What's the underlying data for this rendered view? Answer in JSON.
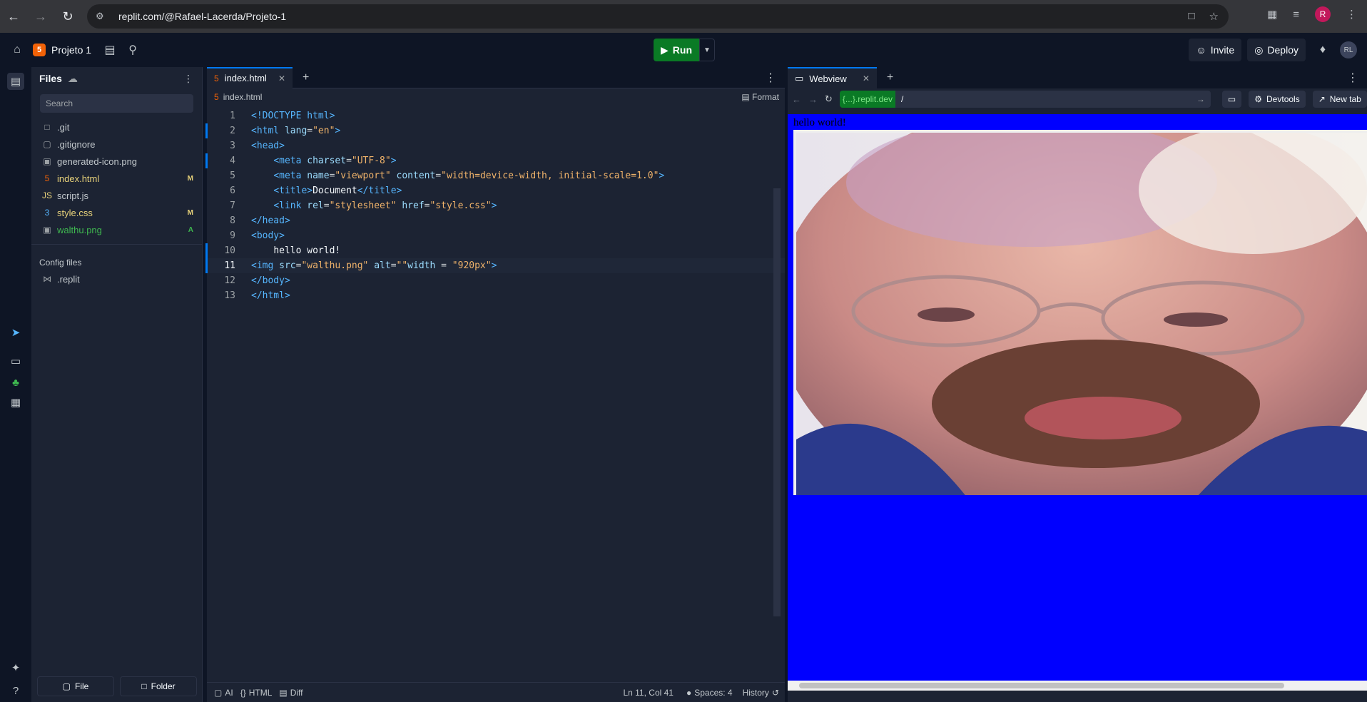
{
  "browser": {
    "url": "replit.com/@Rafael-Lacerda/Projeto-1",
    "profile_initial": "R"
  },
  "app": {
    "project_name": "Projeto 1",
    "run_label": "Run",
    "invite_label": "Invite",
    "deploy_label": "Deploy",
    "avatar_initials": "RL"
  },
  "files": {
    "title": "Files",
    "search_placeholder": "Search",
    "items": [
      {
        "name": ".git",
        "badge": ""
      },
      {
        "name": ".gitignore",
        "badge": ""
      },
      {
        "name": "generated-icon.png",
        "badge": ""
      },
      {
        "name": "index.html",
        "badge": "M"
      },
      {
        "name": "script.js",
        "badge": ""
      },
      {
        "name": "style.css",
        "badge": "M"
      },
      {
        "name": "walthu.png",
        "badge": "A"
      }
    ],
    "config_label": "Config files",
    "config_items": [
      {
        "name": ".replit"
      }
    ],
    "footer_file": "File",
    "footer_folder": "Folder"
  },
  "editor": {
    "tab_label": "index.html",
    "breadcrumb": "index.html",
    "format_label": "Format",
    "lines": [
      "1",
      "2",
      "3",
      "4",
      "5",
      "6",
      "7",
      "8",
      "9",
      "10",
      "11",
      "12",
      "13"
    ],
    "status": {
      "ai": "AI",
      "lang": "HTML",
      "diff": "Diff",
      "position": "Ln 11, Col 41",
      "spaces": "Spaces: 4",
      "history": "History"
    }
  },
  "webview": {
    "tab_label": "Webview",
    "host": "{...}.replit.dev",
    "path": "/",
    "devtools_label": "Devtools",
    "newtab_label": "New tab",
    "page_text": "hello world!"
  },
  "colors": {
    "page_background": "#0000ff",
    "run_green": "#0a7a25",
    "accent": "#0079f2"
  }
}
